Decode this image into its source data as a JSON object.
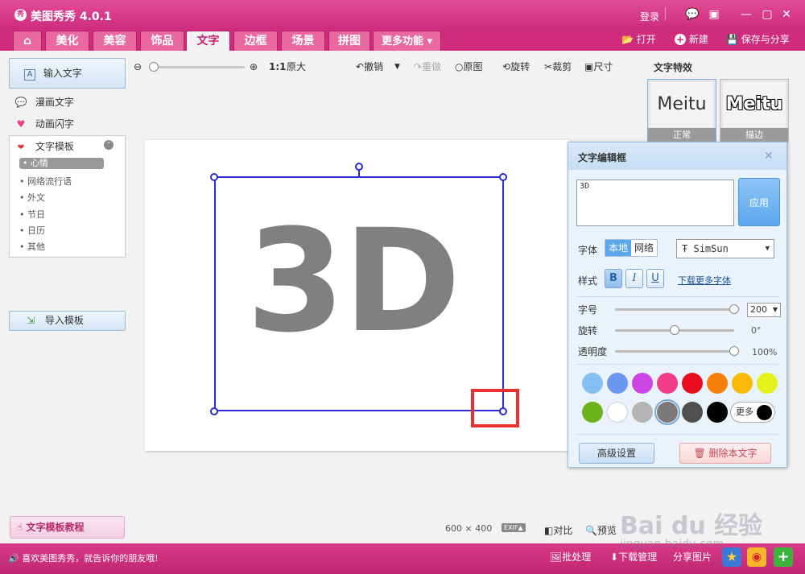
{
  "app": {
    "logo": "秀",
    "title": "美图秀秀 4.0.1",
    "login": "登录"
  },
  "window_controls": [
    "💬",
    "▣",
    "—",
    "▢",
    "✕"
  ],
  "tabs": [
    {
      "label": "⌂",
      "active": false
    },
    {
      "label": "美化",
      "active": false
    },
    {
      "label": "美容",
      "active": false
    },
    {
      "label": "饰品",
      "active": false
    },
    {
      "label": "文字",
      "active": true
    },
    {
      "label": "边框",
      "active": false
    },
    {
      "label": "场景",
      "active": false
    },
    {
      "label": "拼图",
      "active": false
    },
    {
      "label": "更多功能 ▾",
      "active": false
    }
  ],
  "file_menu": {
    "open": "打开",
    "new": "新建",
    "save_share": "保存与分享"
  },
  "left": {
    "input_text": "输入文字",
    "comic_text": "漫画文字",
    "animated_text": "动画闪字",
    "template_header": "文字模板",
    "template_items": [
      "心情",
      "网络流行语",
      "外文",
      "节日",
      "日历",
      "其他"
    ],
    "template_selected_index": 0,
    "import_template": "导入模板",
    "tutorial": "文字模板教程"
  },
  "toolbar": {
    "zoom_ratio": "1:1",
    "original_size": "原大",
    "undo": "撤销",
    "redo": "重做",
    "original": "原图",
    "rotate": "旋转",
    "crop": "裁剪",
    "size": "尺寸"
  },
  "canvas": {
    "text": "3D"
  },
  "effects": {
    "label": "文字特效",
    "cards": [
      {
        "preview": "Meitu",
        "label": "正常"
      },
      {
        "preview": "Meitu",
        "label": "描边"
      }
    ]
  },
  "dialog": {
    "title": "文字编辑框",
    "text_value": "3D",
    "apply": "应用",
    "font_label": "字体",
    "font_source_local": "本地",
    "font_source_web": "网络",
    "font_name": "SimSun",
    "style_label": "样式",
    "bold": "B",
    "italic": "I",
    "underline": "U",
    "download_fonts": "下载更多字体",
    "size_label": "字号",
    "size_value": "200",
    "size_level": 1.0,
    "rotate_label": "旋转",
    "rotate_value": "0°",
    "rotate_level": 0.5,
    "opacity_label": "透明度",
    "opacity_value": "100%",
    "opacity_level": 1.0,
    "colors": [
      "#80c1f2",
      "#6a98ef",
      "#ce45e5",
      "#f23c8b",
      "#ea0d1f",
      "#f7800d",
      "#fbb905",
      "#e4f11d",
      "#6db317",
      "#ffffff",
      "#b4b4b4",
      "#7a7a7a",
      "#505050",
      "#000000"
    ],
    "selected_color_index": 11,
    "more": "更多",
    "advanced": "高级设置",
    "delete": "删除本文字"
  },
  "footer": {
    "dimensions": "600 × 400",
    "exif": "EXIF▲",
    "compare": "对比",
    "preview": "预览"
  },
  "statusbar": {
    "message": "喜欢美图秀秀，就告诉你的朋友哦!",
    "batch": "批处理",
    "download_manager": "下载管理",
    "share_image": "分享图片"
  },
  "watermark": {
    "brand": "Bai du 经验",
    "url": "jingyan.baidu.com"
  }
}
